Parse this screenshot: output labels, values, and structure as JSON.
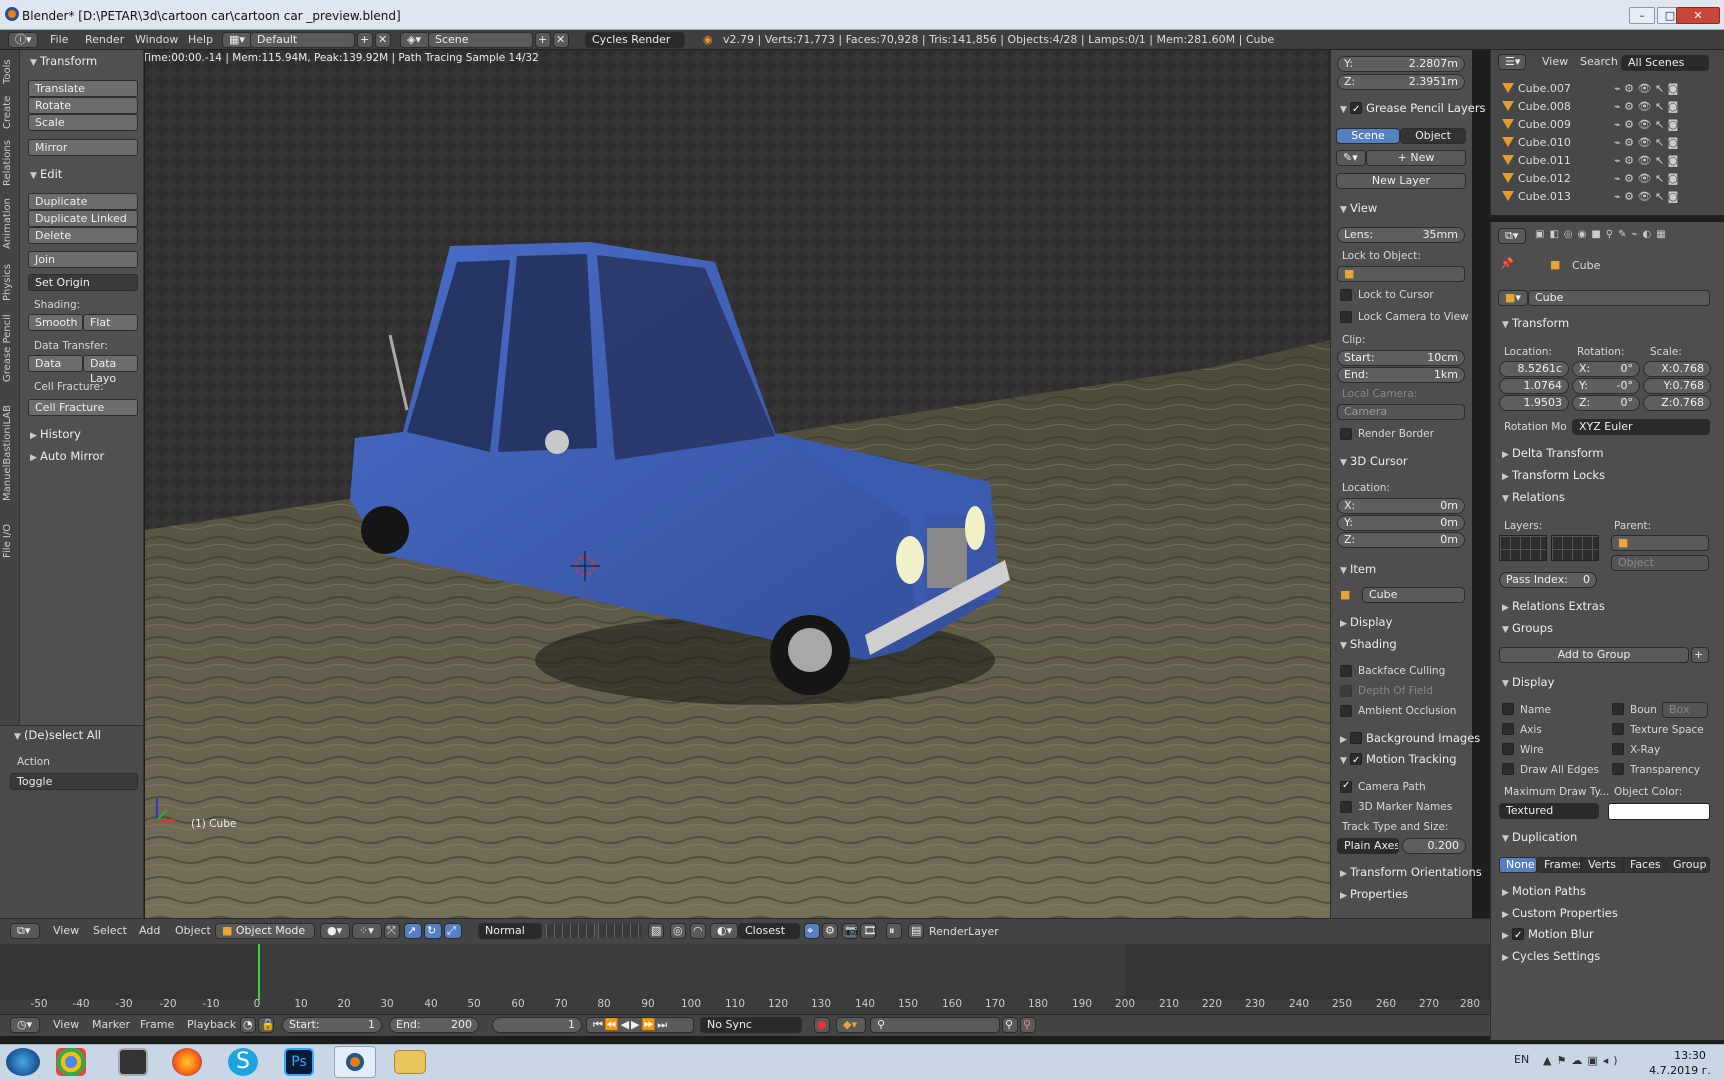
{
  "window": {
    "title": "Blender* [D:\\PETAR\\3d\\cartoon car\\cartoon car _preview.blend]"
  },
  "infobar": {
    "menus": [
      "File",
      "Render",
      "Window",
      "Help"
    ],
    "layout": "Default",
    "scene": "Scene",
    "engine": "Cycles Render",
    "stats": "v2.79 | Verts:71,773 | Faces:70,928 | Tris:141,856 | Objects:4/28 | Lamps:0/1 | Mem:281.60M | Cube"
  },
  "viewport": {
    "render_info": "Time:00:00.-14 | Mem:115.94M, Peak:139.92M | Path Tracing Sample 14/32",
    "object_label": "(1) Cube"
  },
  "toolshelf": {
    "tabs": [
      "Tools",
      "Create",
      "Relations",
      "Animation",
      "Physics",
      "Grease Pencil",
      "ManuelBastioniLAB",
      "File I/O"
    ],
    "transform": {
      "title": "Transform",
      "translate": "Translate",
      "rotate": "Rotate",
      "scale": "Scale",
      "mirror": "Mirror"
    },
    "edit": {
      "title": "Edit",
      "duplicate": "Duplicate",
      "duplicate_linked": "Duplicate Linked",
      "delete": "Delete",
      "join": "Join",
      "set_origin": "Set Origin",
      "shading_label": "Shading:",
      "smooth": "Smooth",
      "flat": "Flat",
      "data_transfer_label": "Data Transfer:",
      "data": "Data",
      "data_layo": "Data Layo",
      "cell_fracture_label": "Cell Fracture:",
      "cell_fracture": "Cell Fracture"
    },
    "history": "History",
    "auto_mirror": "Auto Mirror",
    "operator": {
      "title": "(De)select All",
      "action_label": "Action",
      "action_value": "Toggle"
    }
  },
  "nprops": {
    "y": {
      "label": "Y:",
      "value": "2.2807m"
    },
    "z": {
      "label": "Z:",
      "value": "2.3951m"
    },
    "grease_pencil_layers": "Grease Pencil Layers",
    "scene_btn": "Scene",
    "object_btn": "Object",
    "new_btn": "New",
    "new_layer_btn": "New Layer",
    "view": "View",
    "lens": {
      "label": "Lens:",
      "value": "35mm"
    },
    "lock_to_object": "Lock to Object:",
    "lock_to_cursor": "Lock to Cursor",
    "lock_camera_to_view": "Lock Camera to View",
    "clip": "Clip:",
    "clip_start": {
      "label": "Start:",
      "value": "10cm"
    },
    "clip_end": {
      "label": "End:",
      "value": "1km"
    },
    "local_camera": "Local Camera:",
    "camera": "Camera",
    "render_border": "Render Border",
    "cursor_3d": "3D Cursor",
    "location": "Location:",
    "cx": {
      "label": "X:",
      "value": "0m"
    },
    "cy": {
      "label": "Y:",
      "value": "0m"
    },
    "cz": {
      "label": "Z:",
      "value": "0m"
    },
    "item": "Item",
    "item_name": "Cube",
    "display": "Display",
    "shading": "Shading",
    "backface_culling": "Backface Culling",
    "depth_of_field": "Depth Of Field",
    "ambient_occlusion": "Ambient Occlusion",
    "background_images": "Background Images",
    "motion_tracking": "Motion Tracking",
    "camera_path": "Camera Path",
    "marker_names": "3D Marker Names",
    "track_type_label": "Track Type and Size:",
    "track_type": "Plain Axes",
    "track_size": "0.200",
    "transform_orientations": "Transform Orientations",
    "properties": "Properties"
  },
  "outliner": {
    "view": "View",
    "search": "Search",
    "all_scenes": "All Scenes",
    "items": [
      "Cube.007",
      "Cube.008",
      "Cube.009",
      "Cube.010",
      "Cube.011",
      "Cube.012",
      "Cube.013"
    ]
  },
  "properties": {
    "object_name": "Cube",
    "breadcrumb": "Cube",
    "transform": "Transform",
    "location_label": "Location:",
    "rotation_label": "Rotation:",
    "scale_label": "Scale:",
    "loc": [
      "8.5261c",
      "1.0764",
      "1.9503"
    ],
    "rot": [
      {
        "l": "X:",
        "v": "0°"
      },
      {
        "l": "Y:",
        "v": "-0°"
      },
      {
        "l": "Z:",
        "v": "0°"
      }
    ],
    "scl": [
      "X:0.768",
      "Y:0.768",
      "Z:0.768"
    ],
    "rotation_mode_label": "Rotation Mo",
    "rotation_mode": "XYZ Euler",
    "delta_transform": "Delta Transform",
    "transform_locks": "Transform Locks",
    "relations": "Relations",
    "layers_label": "Layers:",
    "parent_label": "Parent:",
    "parent_placeholder": "Object",
    "pass_index": {
      "label": "Pass Index:",
      "value": "0"
    },
    "relations_extras": "Relations Extras",
    "groups": "Groups",
    "add_to_group": "Add to Group",
    "display": "Display",
    "name": "Name",
    "bounds": "Boun",
    "bounds_type": "Box",
    "axis": "Axis",
    "texture_space": "Texture Space",
    "wire": "Wire",
    "xray": "X-Ray",
    "draw_all_edges": "Draw All Edges",
    "transparency": "Transparency",
    "max_draw_type_label": "Maximum Draw Ty...",
    "object_color_label": "Object Color:",
    "draw_type": "Textured",
    "duplication": "Duplication",
    "dup_none": "None",
    "dup_frames": "Frames",
    "dup_verts": "Verts",
    "dup_faces": "Faces",
    "dup_group": "Group",
    "motion_paths": "Motion Paths",
    "custom_properties": "Custom Properties",
    "motion_blur": "Motion Blur",
    "cycles_settings": "Cycles Settings"
  },
  "view3d_header": {
    "menus": [
      "View",
      "Select",
      "Add",
      "Object"
    ],
    "mode": "Object Mode",
    "pivot": "Normal",
    "snap": "Closest",
    "render_layer": "RenderLayer"
  },
  "timeline": {
    "ticks": [
      "-50",
      "-40",
      "-30",
      "-20",
      "-10",
      "0",
      "10",
      "20",
      "30",
      "40",
      "50",
      "60",
      "70",
      "80",
      "90",
      "100",
      "110",
      "120",
      "130",
      "140",
      "150",
      "160",
      "170",
      "180",
      "190",
      "200",
      "210",
      "220",
      "230",
      "240",
      "250",
      "260",
      "270",
      "280"
    ],
    "menus": [
      "View",
      "Marker",
      "Frame",
      "Playback"
    ],
    "start": {
      "label": "Start:",
      "value": "1"
    },
    "end": {
      "label": "End:",
      "value": "200"
    },
    "current": "1",
    "sync": "No Sync"
  },
  "taskbar": {
    "lang": "EN",
    "time": "13:30",
    "date": "4.7.2019 г."
  },
  "colors": {
    "accent": "#5680c2",
    "car_body": "#3f5fb4",
    "ground": "#5d5a44"
  }
}
